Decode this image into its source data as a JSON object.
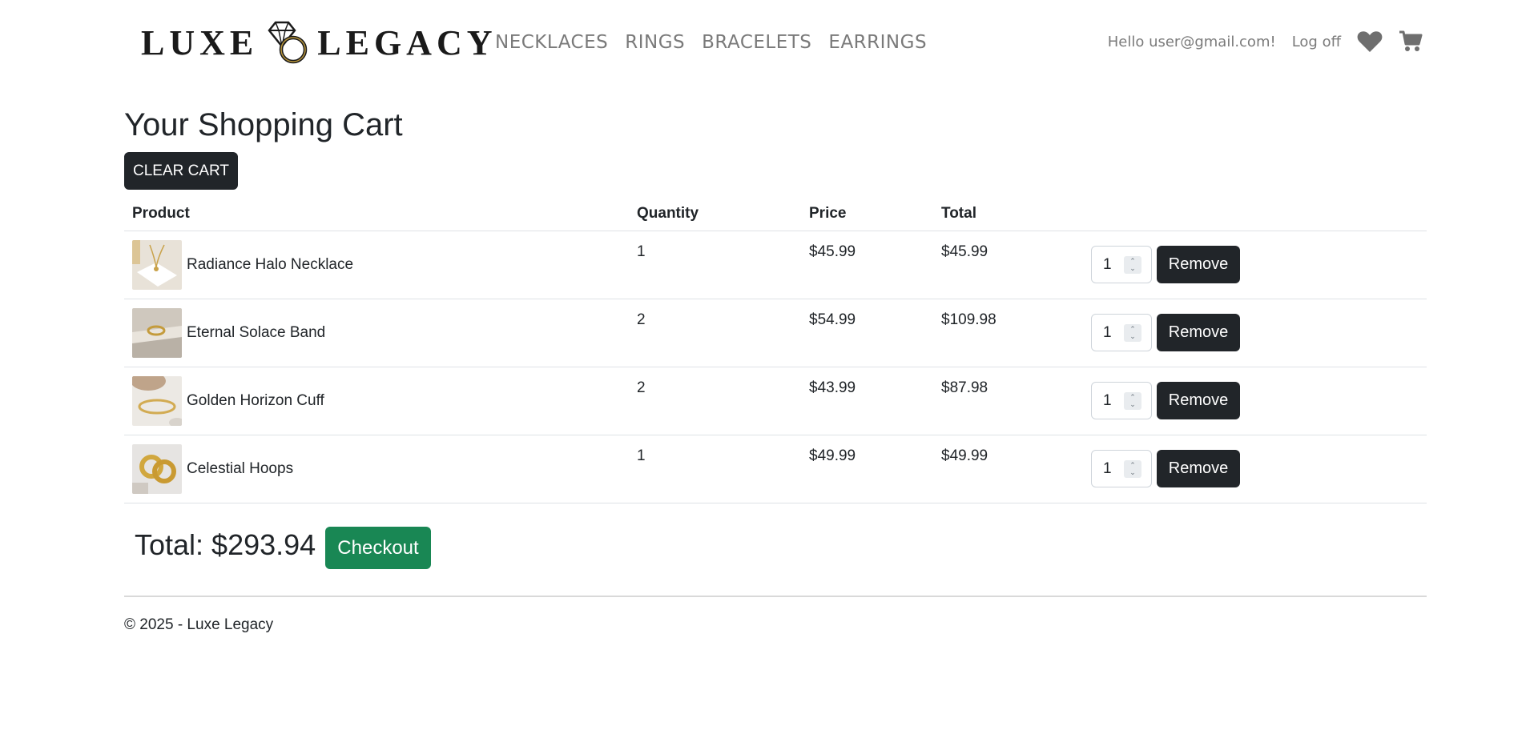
{
  "brand": {
    "word1": "LUXE",
    "word2": "LEGACY"
  },
  "nav": [
    {
      "label": "NECKLACES"
    },
    {
      "label": "RINGS"
    },
    {
      "label": "BRACELETS"
    },
    {
      "label": "EARRINGS"
    }
  ],
  "user": {
    "greeting": "Hello user@gmail.com!",
    "logoff": "Log off"
  },
  "icons": {
    "wishlist": "heart-icon",
    "cart": "cart-icon"
  },
  "page": {
    "title": "Your Shopping Cart",
    "clear_label": "CLEAR CART"
  },
  "table": {
    "headers": {
      "product": "Product",
      "quantity": "Quantity",
      "price": "Price",
      "total": "Total"
    },
    "rows": [
      {
        "name": "Radiance Halo Necklace",
        "qty": "1",
        "price": "$45.99",
        "total": "$45.99",
        "input_value": "1",
        "remove": "Remove"
      },
      {
        "name": "Eternal Solace Band",
        "qty": "2",
        "price": "$54.99",
        "total": "$109.98",
        "input_value": "1",
        "remove": "Remove"
      },
      {
        "name": "Golden Horizon Cuff",
        "qty": "2",
        "price": "$43.99",
        "total": "$87.98",
        "input_value": "1",
        "remove": "Remove"
      },
      {
        "name": "Celestial Hoops",
        "qty": "1",
        "price": "$49.99",
        "total": "$49.99",
        "input_value": "1",
        "remove": "Remove"
      }
    ]
  },
  "summary": {
    "total_text": "Total: $293.94",
    "checkout_label": "Checkout"
  },
  "footer": {
    "copyright": "© 2025 - Luxe Legacy"
  },
  "colors": {
    "dark_button": "#212529",
    "checkout": "#198754",
    "nav_text": "#7a7a7a"
  }
}
